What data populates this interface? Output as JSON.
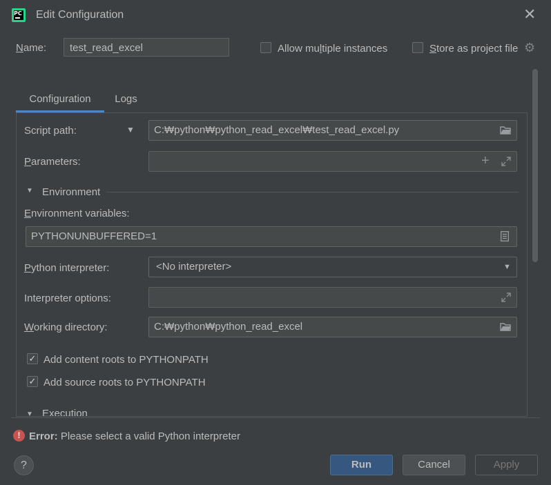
{
  "window": {
    "title": "Edit Configuration"
  },
  "name_row": {
    "name_label_prefix": "N",
    "name_label_rest": "ame:",
    "name_value": "test_read_excel",
    "allow_multiple_pre": "Allow mu",
    "allow_multiple_u": "l",
    "allow_multiple_post": "tiple instances",
    "store_pre": "",
    "store_u": "S",
    "store_post": "tore as project file"
  },
  "tabs": [
    {
      "label": "Configuration",
      "selected": true
    },
    {
      "label": "Logs",
      "selected": false
    }
  ],
  "config": {
    "script_path_label": "Script path:",
    "script_path_value": "C:₩python₩python_read_excel₩test_read_excel.py",
    "params_label_u": "P",
    "params_label_rest": "arameters:",
    "params_value": "",
    "environment_section": "Environment",
    "env_vars_label_u": "E",
    "env_vars_label_rest": "nvironment variables:",
    "env_vars_value": "PYTHONUNBUFFERED=1",
    "interpreter_label_u": "P",
    "interpreter_label_rest": "ython interpreter:",
    "interpreter_value": "<No interpreter>",
    "interp_options_label": "Interpreter options:",
    "interp_options_value": "",
    "workdir_label_u": "W",
    "workdir_label_rest": "orking directory:",
    "workdir_value": "C:₩python₩python_read_excel",
    "content_roots_label": "Add content roots to PYTHONPATH",
    "content_roots_checked": true,
    "source_roots_label": "Add source roots to PYTHONPATH",
    "source_roots_checked": true,
    "execution_section": "Execution"
  },
  "error": {
    "prefix": "Error:",
    "message": " Please select a valid Python interpreter"
  },
  "buttons": {
    "help": "?",
    "run": "Run",
    "cancel": "Cancel",
    "apply": "Apply"
  },
  "icons": {
    "app": "pycharm-icon",
    "close": "close-icon",
    "gear": "gear-icon",
    "folder": "folder-icon",
    "expand": "expand-icon",
    "plus": "plus-icon",
    "error": "error-icon"
  },
  "colors": {
    "background": "#3c3f41",
    "accent": "#4a88c7",
    "run_button": "#365880",
    "error": "#c75450"
  }
}
